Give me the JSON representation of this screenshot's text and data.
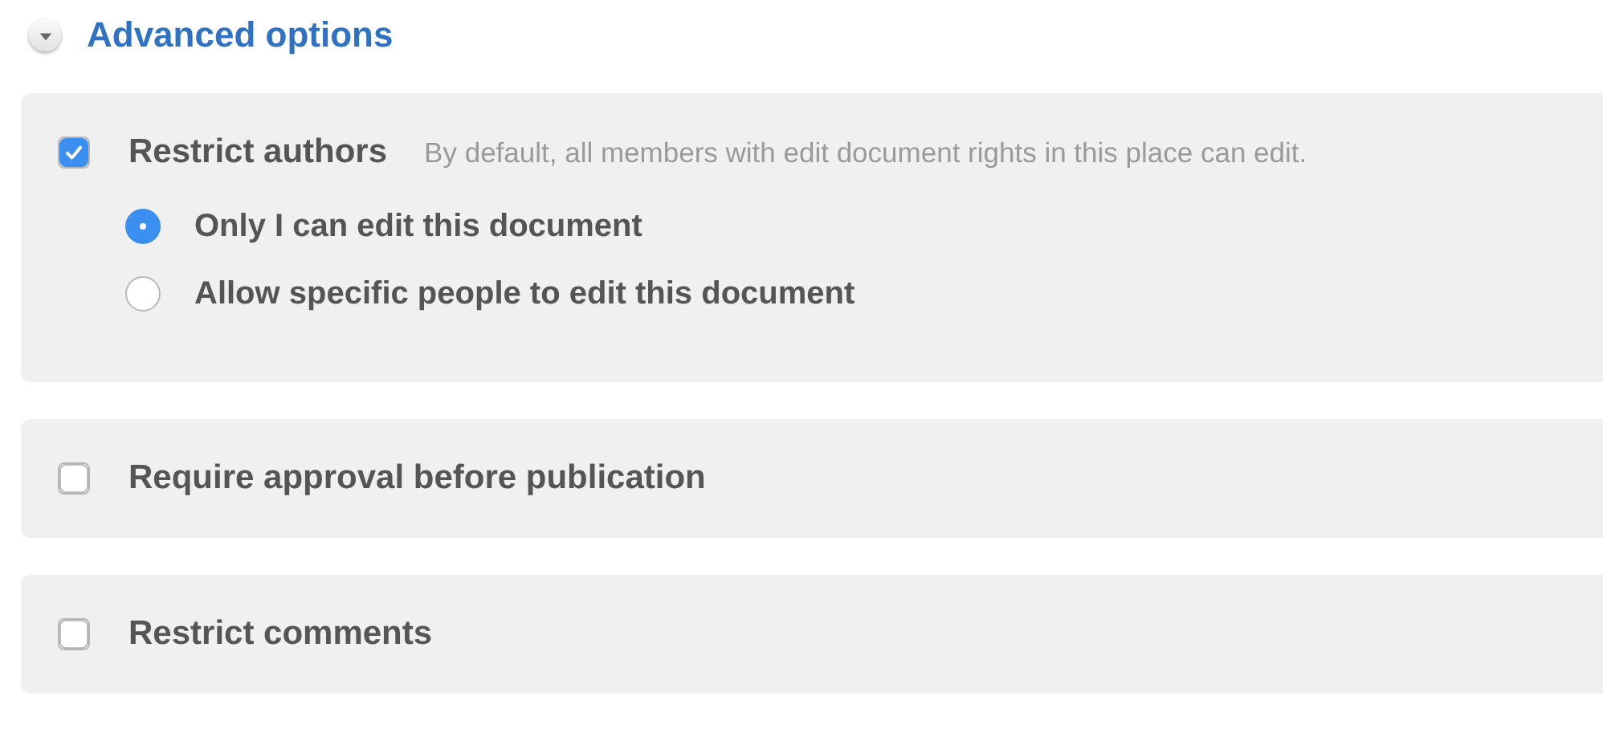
{
  "section": {
    "title": "Advanced options",
    "expanded": true
  },
  "options": [
    {
      "label": "Restrict authors",
      "description": "By default, all members with edit document rights in this place can edit.",
      "checked": true,
      "choices": [
        {
          "label": "Only I can edit this document",
          "selected": true
        },
        {
          "label": "Allow specific people to edit this document",
          "selected": false
        }
      ]
    },
    {
      "label": "Require approval before publication",
      "checked": false
    },
    {
      "label": "Restrict comments",
      "checked": false
    }
  ]
}
